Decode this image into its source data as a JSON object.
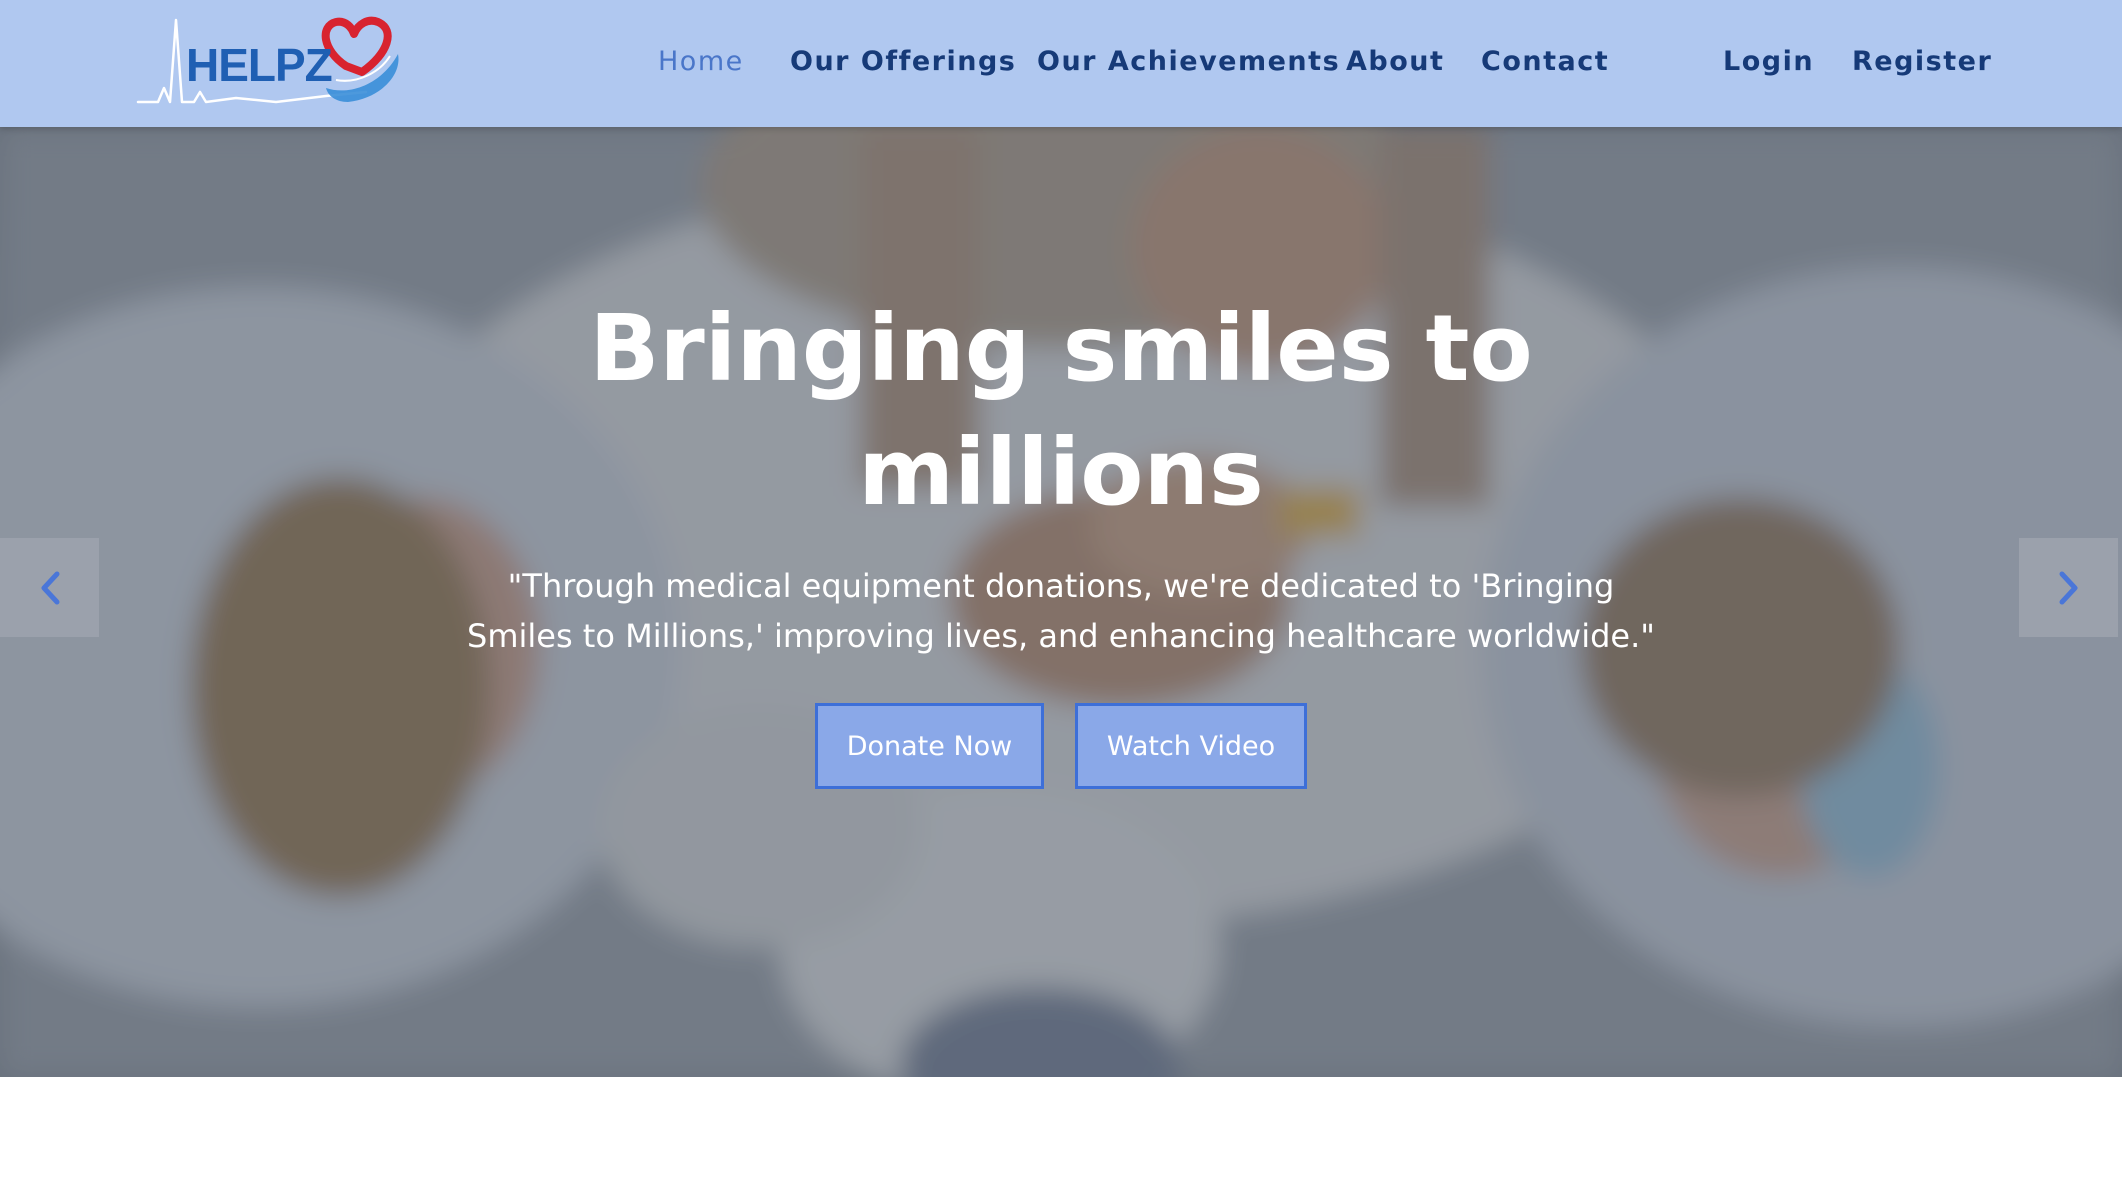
{
  "brand": {
    "logo_text": "HELPZ",
    "icon": "heart-pulse-logo-icon",
    "colors": {
      "primary": "#1f5fb3",
      "heart": "#d8232f",
      "hand": "#3a8ed8"
    }
  },
  "nav": {
    "background": "#b0c8f0",
    "items": [
      {
        "label": "Home",
        "active": true
      },
      {
        "label": "Our Offerings",
        "active": false
      },
      {
        "label": "Our Achievements",
        "active": false
      },
      {
        "label": "About",
        "active": false
      },
      {
        "label": "Contact",
        "active": false
      }
    ],
    "auth": {
      "login": "Login",
      "register": "Register"
    }
  },
  "hero": {
    "title_line1": "Bringing smiles to",
    "title_line2": "millions",
    "subtitle": "\"Through medical equipment donations, we're dedicated to 'Bringing Smiles to Millions,' improving lives, and enhancing healthcare worldwide.\"",
    "buttons": {
      "donate": "Donate Now",
      "video": "Watch Video"
    },
    "controls": {
      "prev_icon": "chevron-left-icon",
      "next_icon": "chevron-right-icon"
    },
    "button_color": "#8aa8e8",
    "button_border": "#3d6fd8"
  }
}
